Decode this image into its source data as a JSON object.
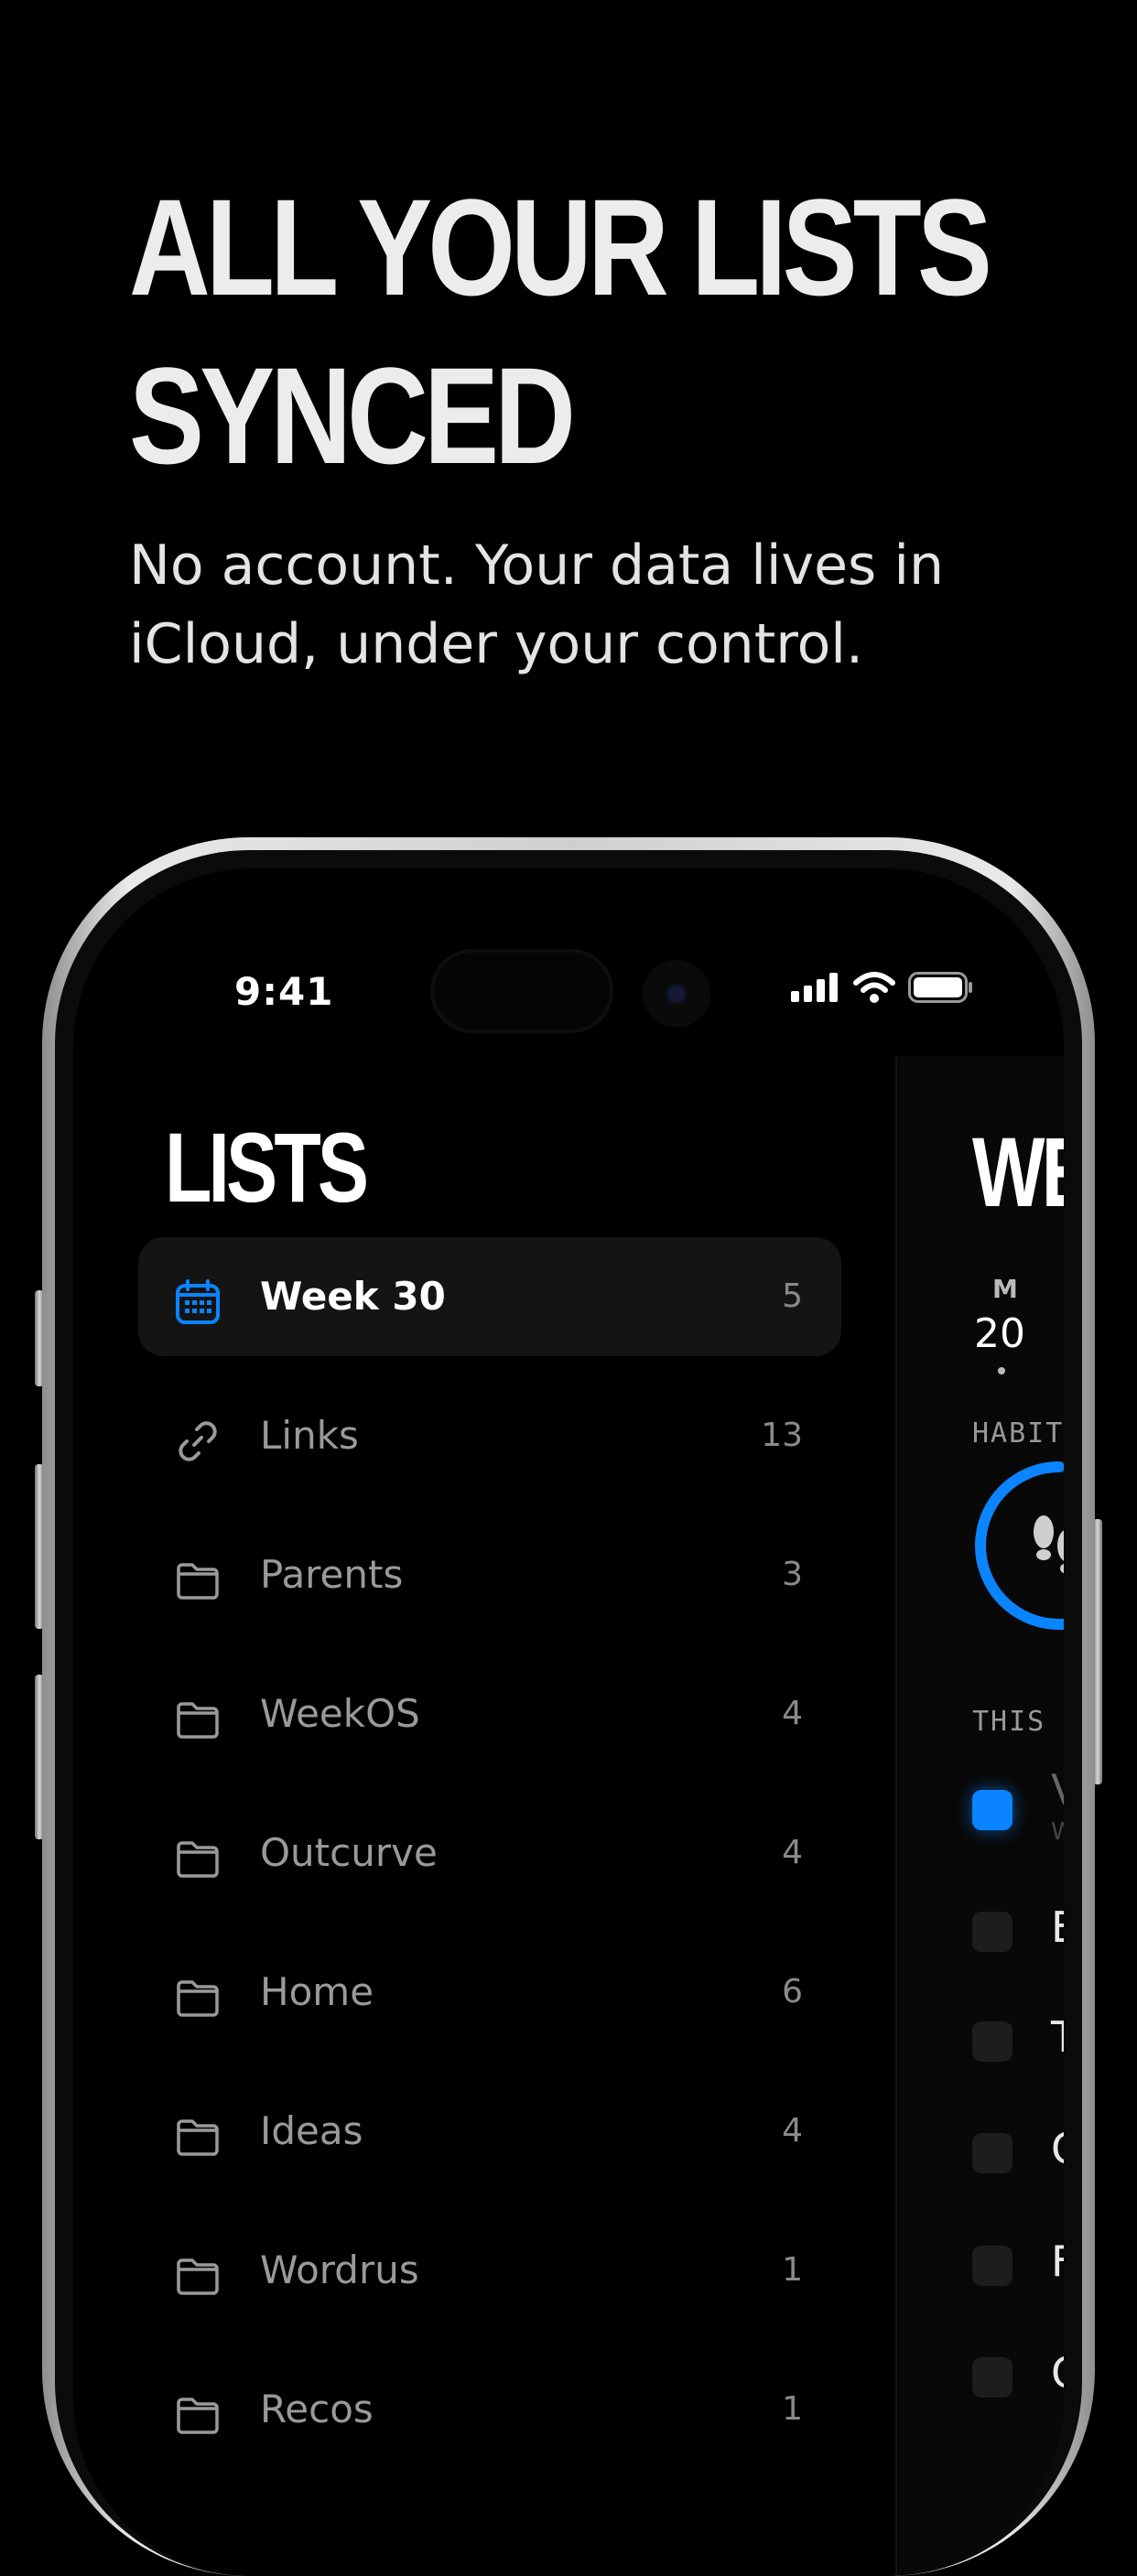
{
  "headline": {
    "line1": "ALL YOUR LISTS",
    "line2": "SYNCED"
  },
  "subhead": {
    "line1": "No account. Your data lives in",
    "line2": "iCloud, under your control."
  },
  "status_bar": {
    "time": "9:41"
  },
  "sidebar": {
    "title": "LISTS",
    "items": [
      {
        "label": "Week 30",
        "count": "5",
        "icon": "calendar-icon",
        "selected": true
      },
      {
        "label": "Links",
        "count": "13",
        "icon": "link-icon"
      },
      {
        "label": "Parents",
        "count": "3",
        "icon": "folder-icon"
      },
      {
        "label": "WeekOS",
        "count": "4",
        "icon": "folder-icon"
      },
      {
        "label": "Outcurve",
        "count": "4",
        "icon": "folder-icon"
      },
      {
        "label": "Home",
        "count": "6",
        "icon": "folder-icon"
      },
      {
        "label": "Ideas",
        "count": "4",
        "icon": "folder-icon"
      },
      {
        "label": "Wordrus",
        "count": "1",
        "icon": "folder-icon"
      },
      {
        "label": "Recos",
        "count": "1",
        "icon": "folder-icon"
      }
    ]
  },
  "detail": {
    "title": "WE",
    "day_label": "M",
    "date": "20",
    "habits_label": "HABITS",
    "this_week_label": "THIS W",
    "tasks": [
      {
        "letter": "V",
        "sub": "W",
        "done": true
      },
      {
        "letter": "E",
        "done": false
      },
      {
        "letter": "T",
        "done": false
      },
      {
        "letter": "C",
        "done": false
      },
      {
        "letter": "F",
        "done": false
      },
      {
        "letter": "C",
        "done": false
      }
    ]
  },
  "colors": {
    "accent": "#0a84ff",
    "background": "#000000",
    "selected_row": "#141414"
  }
}
